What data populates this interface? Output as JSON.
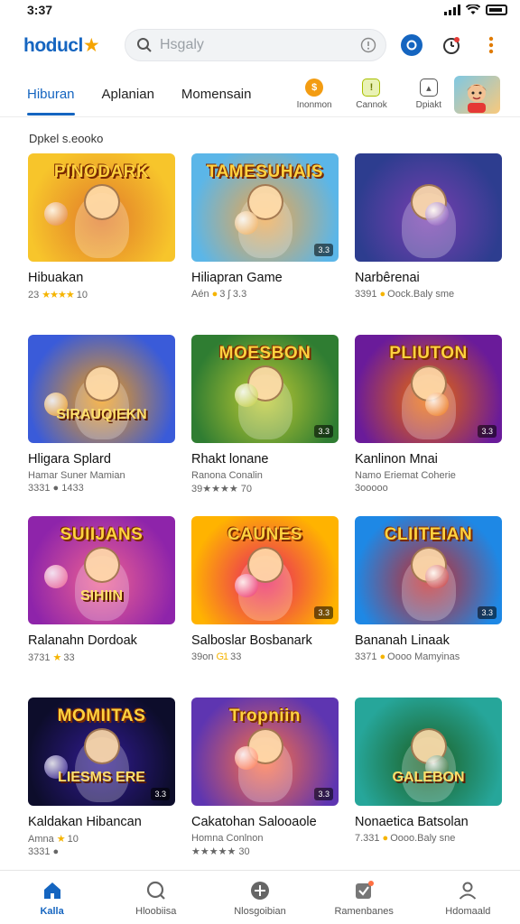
{
  "status": {
    "time": "3:37"
  },
  "app": {
    "logo_main": "hoducl",
    "logo_accent": "★"
  },
  "search": {
    "placeholder": "Hsgaly",
    "value": ""
  },
  "tabs": [
    {
      "label": "Hiburan",
      "active": true
    },
    {
      "label": "Aplanian",
      "active": false
    },
    {
      "label": "Momensain",
      "active": false
    }
  ],
  "quick_actions": [
    {
      "label": "Inonmon",
      "icon": "coin-icon",
      "color": "#f39c12"
    },
    {
      "label": "Cannok",
      "icon": "info-icon",
      "color": "#a8c000"
    },
    {
      "label": "Dpiakt",
      "icon": "gallery-icon",
      "color": "#555555"
    }
  ],
  "section": {
    "title": "Dpkel s.eooko"
  },
  "games": [
    {
      "name": "Hibuakan",
      "thumb_title": "PINODARK",
      "thumb_sub": "",
      "meta": "23",
      "stars": "★★★★",
      "meta_tail": "10",
      "meta2": "",
      "badge": "",
      "bg": [
        "#f7c52b",
        "#e1792a"
      ]
    },
    {
      "name": "Hiliapran Game",
      "thumb_title": "TAMESUHAIS",
      "thumb_sub": "",
      "meta": "Aén",
      "stars": "●",
      "meta_tail": "3 ʃ 3.3",
      "meta2": "",
      "badge": "3.3",
      "bg": [
        "#5bb6e8",
        "#f0a64a"
      ]
    },
    {
      "name": "Narbêrenai",
      "thumb_title": "",
      "thumb_sub": "",
      "meta": "3391",
      "stars": "●",
      "meta_tail": "Oock.Baly sme",
      "meta2": "",
      "badge": "",
      "bg": [
        "#2d3d8f",
        "#7a3fb0"
      ]
    },
    {
      "name": "Hligara Splard",
      "thumb_title": "",
      "thumb_sub": "SIRAUQIEKN",
      "meta": "Hamar Suner Mamian",
      "stars": "",
      "meta_tail": "",
      "meta2": "3331 ● 1433",
      "badge": "",
      "bg": [
        "#3a5bd9",
        "#f39c12"
      ]
    },
    {
      "name": "Rhakt lonane",
      "thumb_title": "MOESBON",
      "thumb_sub": "",
      "meta": "Ranona Conalin",
      "stars": "",
      "meta_tail": "",
      "meta2": "39★★★★ 70",
      "badge": "3.3",
      "bg": [
        "#2f7d32",
        "#c0ca33"
      ]
    },
    {
      "name": "Kanlinon Mnai",
      "thumb_title": "PLIUTON",
      "thumb_sub": "",
      "meta": "Namo Eriemat Coherie",
      "stars": "",
      "meta_tail": "",
      "meta2": "3ooooo",
      "badge": "3.3",
      "bg": [
        "#6a1b9a",
        "#ef6c00"
      ]
    },
    {
      "name": "Ralanahn Dordoak",
      "thumb_title": "SUIIJANS",
      "thumb_sub": "SIHIIN",
      "meta": "3731",
      "stars": "★",
      "meta_tail": "33",
      "meta2": "",
      "badge": "",
      "bg": [
        "#8e24aa",
        "#f06292"
      ]
    },
    {
      "name": "Salboslar Bosbanark",
      "thumb_title": "CAUNES",
      "thumb_sub": "",
      "meta": "39on",
      "stars": "G1",
      "meta_tail": "33",
      "meta2": "",
      "badge": "3.3",
      "bg": [
        "#ffb300",
        "#e91e63"
      ]
    },
    {
      "name": "Bananah Linaak",
      "thumb_title": "CLIITEIAN",
      "thumb_sub": "",
      "meta": "3371",
      "stars": "●",
      "meta_tail": "Oooo Mamyinas",
      "meta2": "",
      "badge": "3.3",
      "bg": [
        "#1e88e5",
        "#c62828"
      ]
    },
    {
      "name": "Kaldakan Hibancan",
      "thumb_title": "MOMIITAS",
      "thumb_sub": "LIESMS ERE",
      "meta": "Amna",
      "stars": "★",
      "meta_tail": "10",
      "meta2": "3331 ●",
      "badge": "3.3",
      "bg": [
        "#0d0d2b",
        "#311b92"
      ]
    },
    {
      "name": "Cakatohan Salooaole",
      "thumb_title": "Tropniin",
      "thumb_sub": "",
      "meta": "Homna Conlnon",
      "stars": "",
      "meta_tail": "",
      "meta2": "★★★★★ 30",
      "badge": "3.3",
      "bg": [
        "#5e35b1",
        "#ff7043"
      ]
    },
    {
      "name": "Nonaetica Batsolan",
      "thumb_title": "",
      "thumb_sub": "GALEBON",
      "meta": "7.331",
      "stars": "●",
      "meta_tail": "Oooo.Baly sne",
      "meta2": "",
      "badge": "",
      "bg": [
        "#26a69a",
        "#1b5e20"
      ]
    }
  ],
  "nav": [
    {
      "label": "Kalla",
      "icon": "home-icon",
      "active": true
    },
    {
      "label": "Hloobiisa",
      "icon": "search-icon",
      "active": false
    },
    {
      "label": "Nlosgoibian",
      "icon": "compass-icon",
      "active": false
    },
    {
      "label": "Ramenbanes",
      "icon": "check-icon",
      "active": false
    },
    {
      "label": "Hdomaald",
      "icon": "profile-icon",
      "active": false
    }
  ]
}
